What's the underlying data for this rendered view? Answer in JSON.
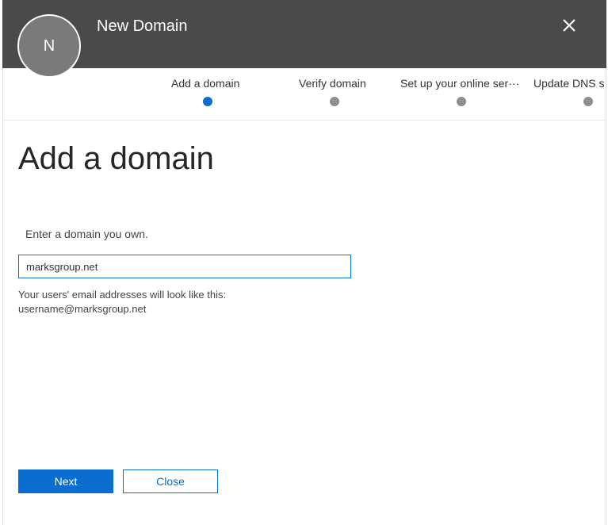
{
  "header": {
    "avatar_initial": "N",
    "title": "New Domain",
    "close_icon": "close-icon"
  },
  "steps": [
    {
      "label": "Add a domain",
      "active": true
    },
    {
      "label": "Verify domain",
      "active": false
    },
    {
      "label": "Set up your online ser···",
      "active": false
    },
    {
      "label": "Update DNS s",
      "active": false
    }
  ],
  "main": {
    "heading": "Add a domain",
    "prompt": "Enter a domain you own.",
    "domain_value": "marksgroup.net",
    "hint_line1": "Your users' email addresses will look like this:",
    "hint_line2": "username@marksgroup.net"
  },
  "footer": {
    "next_label": "Next",
    "close_label": "Close"
  },
  "colors": {
    "header_bg": "#4a4a4a",
    "accent": "#0a6ed1",
    "inactive_dot": "#8f8f8f"
  }
}
